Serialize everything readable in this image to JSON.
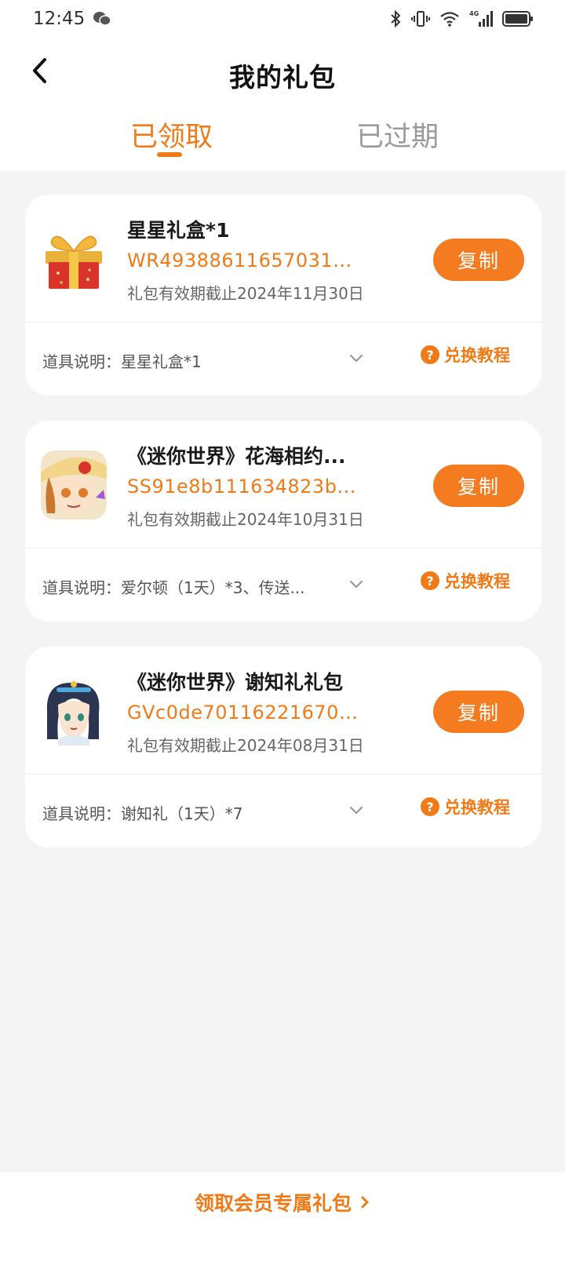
{
  "status_bar": {
    "time": "12:45",
    "icons": [
      "wechat-icon",
      "bluetooth-icon",
      "vibrate-icon",
      "wifi-icon",
      "signal-4g-icon",
      "battery-icon"
    ],
    "network": "4G"
  },
  "header": {
    "title": "我的礼包"
  },
  "tabs": [
    {
      "label": "已领取",
      "active": true
    },
    {
      "label": "已过期",
      "active": false
    }
  ],
  "gifts": [
    {
      "icon": "gift-box-icon",
      "name": "星星礼盒*1",
      "code": "WR493886116570319...",
      "expiry": "礼包有效期截止2024年11月30日",
      "copy_label": "复制",
      "desc": "道具说明：星星礼盒*1",
      "tutorial_label": "兑换教程"
    },
    {
      "icon": "game-character-icon",
      "name": "《迷你世界》花海相约...",
      "code": "SS91e8b111634823b...",
      "expiry": "礼包有效期截止2024年10月31日",
      "copy_label": "复制",
      "desc": "道具说明：爱尔顿（1天）*3、传送...",
      "tutorial_label": "兑换教程"
    },
    {
      "icon": "game-character-icon",
      "name": "《迷你世界》谢知礼礼包",
      "code": "GVc0de70116221670f...",
      "expiry": "礼包有效期截止2024年08月31日",
      "copy_label": "复制",
      "desc": "道具说明：谢知礼（1天）*7",
      "tutorial_label": "兑换教程"
    }
  ],
  "footer": {
    "link_label": "领取会员专属礼包"
  },
  "colors": {
    "accent": "#f07a17",
    "button": "#f47b20",
    "background": "#f4f4f4"
  }
}
